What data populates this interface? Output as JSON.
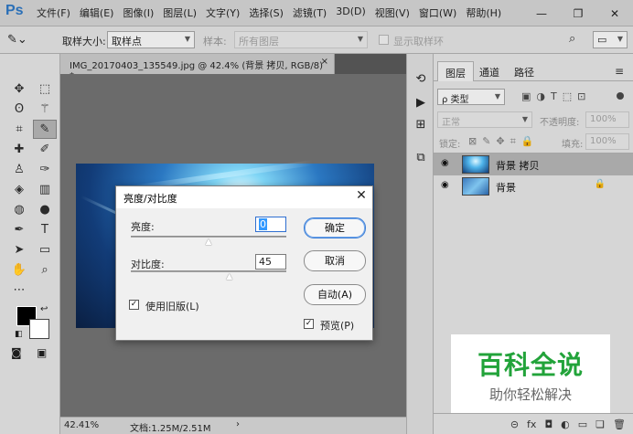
{
  "app": {
    "logo": "Ps"
  },
  "menu": [
    "文件(F)",
    "编辑(E)",
    "图像(I)",
    "图层(L)",
    "文字(Y)",
    "选择(S)",
    "滤镜(T)",
    "3D(D)",
    "视图(V)",
    "窗口(W)",
    "帮助(H)"
  ],
  "window_controls": {
    "minimize": "—",
    "restore": "❐",
    "close": "✕"
  },
  "options": {
    "sample_size_label": "取样大小:",
    "sample_size_value": "取样点",
    "sample_label": "样本:",
    "sample_value": "所有图层",
    "show_ring_label": "显示取样环"
  },
  "document": {
    "tab_title": "IMG_20170403_135549.jpg @ 42.4% (背景 拷贝, RGB/8) *",
    "close": "×"
  },
  "status": {
    "zoom": "42.41%",
    "doc_info": "文档:1.25M/2.51M",
    "arrow": "›"
  },
  "panel": {
    "tabs": [
      "图层",
      "通道",
      "路径"
    ],
    "kind_label": "ρ 类型",
    "blend_mode": "正常",
    "opacity_label": "不透明度:",
    "opacity_value": "100%",
    "lock_label": "锁定:",
    "fill_label": "填充:",
    "fill_value": "100%",
    "layers": [
      {
        "name": "背景 拷贝",
        "selected": true,
        "locked": false
      },
      {
        "name": "背景",
        "selected": false,
        "locked": true
      }
    ],
    "footer_icons": [
      "link-icon",
      "fx-icon",
      "mask-icon",
      "adjustment-icon",
      "group-icon",
      "new-layer-icon",
      "trash-icon"
    ]
  },
  "dialog": {
    "title": "亮度/对比度",
    "close": "✕",
    "brightness_label": "亮度:",
    "brightness_value": "0",
    "brightness_level": 0,
    "contrast_label": "对比度:",
    "contrast_value": "45",
    "contrast_level": 45,
    "use_legacy_label": "使用旧版(L)",
    "use_legacy_checked": true,
    "ok_label": "确定",
    "cancel_label": "取消",
    "auto_label": "自动(A)",
    "preview_label": "预览(P)",
    "preview_checked": true
  },
  "watermark": {
    "title": "百科全说",
    "subtitle": "助你轻松解决"
  }
}
